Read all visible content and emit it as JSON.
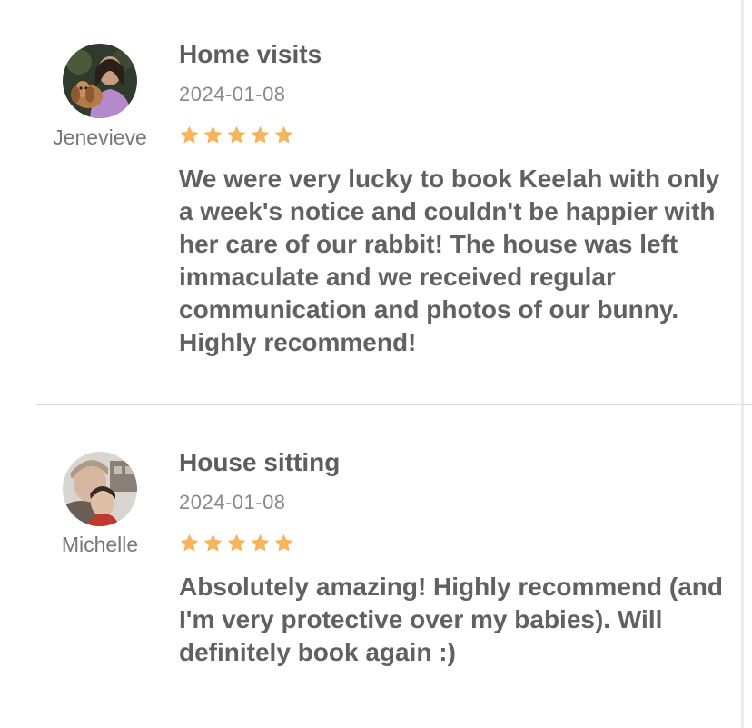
{
  "reviews": [
    {
      "reviewer": "Jenevieve",
      "service": "Home visits",
      "date": "2024-01-08",
      "rating": 5,
      "text": "We were very lucky to book Keelah with only a week's notice and couldn't be happier with her care of our rabbit! The house was left immaculate and we received regular communication and photos of our bunny. Highly recommend!"
    },
    {
      "reviewer": "Michelle",
      "service": "House sitting",
      "date": "2024-01-08",
      "rating": 5,
      "text": "Absolutely amazing! Highly recommend (and I'm very protective over my babies). Will definitely book again :)"
    }
  ],
  "colors": {
    "star": "#f6b45c",
    "divider": "#dedede"
  },
  "icons": {
    "rating_star": "star-icon"
  }
}
